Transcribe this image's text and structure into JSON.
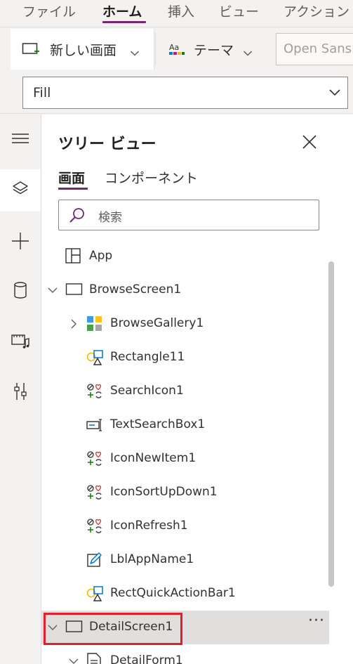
{
  "menu": {
    "tabs": [
      "ファイル",
      "ホーム",
      "挿入",
      "ビュー",
      "アクション"
    ],
    "active_index": 1
  },
  "ribbon": {
    "new_screen_label": "新しい画面",
    "theme_label": "テーマ",
    "font_value": "Open Sans"
  },
  "formula": {
    "property_value": "Fill"
  },
  "rail": {
    "items": [
      "hamburger-icon",
      "layers-icon",
      "plus-icon",
      "database-icon",
      "media-icon",
      "tools-icon"
    ],
    "active_index": 1
  },
  "panel": {
    "title": "ツリー ビュー",
    "tabs": [
      "画面",
      "コンポーネント"
    ],
    "active_tab": 0,
    "search_placeholder": "検索"
  },
  "tree": {
    "items": [
      {
        "label": "App",
        "icon": "app-icon",
        "level": 0,
        "expander": "none"
      },
      {
        "label": "BrowseScreen1",
        "icon": "screen-icon",
        "level": 0,
        "expander": "expanded"
      },
      {
        "label": "BrowseGallery1",
        "icon": "gallery-icon",
        "level": 1,
        "expander": "collapsed"
      },
      {
        "label": "Rectangle11",
        "icon": "shape-icon",
        "level": 1,
        "expander": "none"
      },
      {
        "label": "SearchIcon1",
        "icon": "icon-control-icon",
        "level": 1,
        "expander": "none"
      },
      {
        "label": "TextSearchBox1",
        "icon": "textinput-icon",
        "level": 1,
        "expander": "none"
      },
      {
        "label": "IconNewItem1",
        "icon": "icon-control-icon",
        "level": 1,
        "expander": "none"
      },
      {
        "label": "IconSortUpDown1",
        "icon": "icon-control-icon",
        "level": 1,
        "expander": "none"
      },
      {
        "label": "IconRefresh1",
        "icon": "icon-control-icon",
        "level": 1,
        "expander": "none"
      },
      {
        "label": "LblAppName1",
        "icon": "label-icon",
        "level": 1,
        "expander": "none"
      },
      {
        "label": "RectQuickActionBar1",
        "icon": "shape-icon",
        "level": 1,
        "expander": "none"
      },
      {
        "label": "DetailScreen1",
        "icon": "screen-icon",
        "level": 0,
        "expander": "expanded",
        "selected": true,
        "more": "···"
      },
      {
        "label": "DetailForm1",
        "icon": "form-icon",
        "level": 1,
        "expander": "expanded"
      }
    ]
  },
  "colors": {
    "accent": "#742774",
    "highlight": "#e0202a",
    "selected_row": "#e1dfdd"
  }
}
